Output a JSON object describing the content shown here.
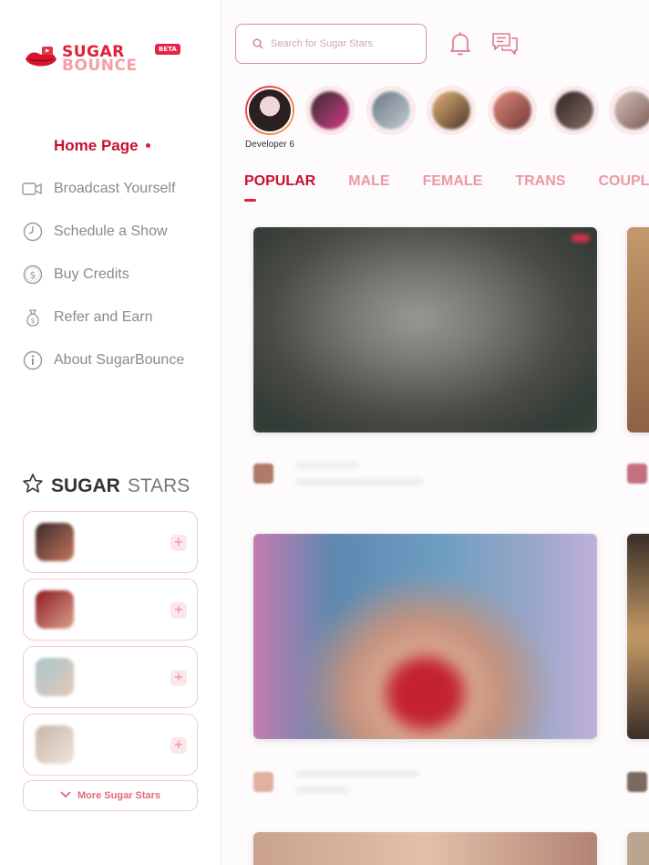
{
  "brand": {
    "line1": "SUGAR",
    "line2": "BOUNCE",
    "badge": "BETA"
  },
  "nav": {
    "items": [
      {
        "label": "Home Page",
        "icon": "home-icon",
        "active": true
      },
      {
        "label": "Broadcast Yourself",
        "icon": "video-camera-icon",
        "active": false
      },
      {
        "label": "Schedule a Show",
        "icon": "clock-icon",
        "active": false
      },
      {
        "label": "Buy Credits",
        "icon": "dollar-coin-icon",
        "active": false
      },
      {
        "label": "Refer and Earn",
        "icon": "money-bag-icon",
        "active": false
      },
      {
        "label": "About SugarBounce",
        "icon": "info-icon",
        "active": false
      }
    ]
  },
  "sugar_stars": {
    "title_bold": "SUGAR",
    "title_light": "STARS",
    "cards": [
      {
        "name": "",
        "sub": "",
        "colors": [
          "#3a2a2a",
          "#c7755d"
        ]
      },
      {
        "name": "",
        "sub": "",
        "colors": [
          "#8e1a24",
          "#d8a088"
        ]
      },
      {
        "name": "",
        "sub": "",
        "colors": [
          "#a8c6cc",
          "#e3c9b8"
        ]
      },
      {
        "name": "",
        "sub": "",
        "colors": [
          "#c9b6a8",
          "#efe4dc"
        ]
      }
    ],
    "add_label": "+",
    "more_label": "More Sugar Stars"
  },
  "header": {
    "search_placeholder": "Search for Sugar Stars",
    "bell_icon": "bell-icon",
    "chat_icon": "chat-bubbles-icon"
  },
  "stories": [
    {
      "label": "Developer 6",
      "main": true,
      "colors": [
        "#f1d6d8",
        "#2b2020"
      ]
    },
    {
      "label": "",
      "main": false,
      "colors": [
        "#3a2d2d",
        "#d03a8a"
      ]
    },
    {
      "label": "",
      "main": false,
      "colors": [
        "#6b7a85",
        "#c3c9d0"
      ]
    },
    {
      "label": "",
      "main": false,
      "colors": [
        "#e4b377",
        "#4b3527"
      ]
    },
    {
      "label": "",
      "main": false,
      "colors": [
        "#e58a7e",
        "#6d3a33"
      ]
    },
    {
      "label": "",
      "main": false,
      "colors": [
        "#2d2424",
        "#8a6e63"
      ]
    },
    {
      "label": "",
      "main": false,
      "colors": [
        "#d8c2bd",
        "#7a5a52"
      ]
    }
  ],
  "tabs": [
    {
      "label": "POPULAR",
      "active": true
    },
    {
      "label": "MALE",
      "active": false
    },
    {
      "label": "FEMALE",
      "active": false
    },
    {
      "label": "TRANS",
      "active": false
    },
    {
      "label": "COUPLES",
      "active": false
    }
  ],
  "colors": {
    "accent": "#c8102e",
    "accent_light": "#ec98a6",
    "border_pink": "#f3c9cf"
  }
}
